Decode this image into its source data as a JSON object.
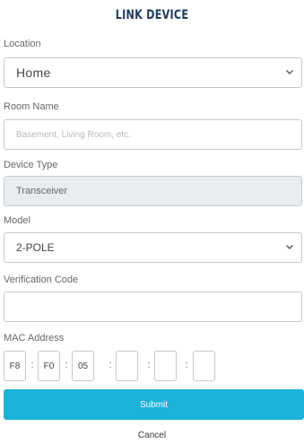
{
  "page": {
    "title": "LINK DEVICE"
  },
  "form": {
    "location": {
      "label": "Location",
      "value": "Home"
    },
    "room_name": {
      "label": "Room Name",
      "placeholder": "Basement, Living Room, etc.",
      "value": ""
    },
    "device_type": {
      "label": "Device Type",
      "value": "Transceiver"
    },
    "model": {
      "label": "Model",
      "value": "2-POLE"
    },
    "verification_code": {
      "label": "Verification Code",
      "value": ""
    },
    "mac_address": {
      "label": "MAC Address",
      "octets": [
        "F8",
        "F0",
        "05",
        "",
        "",
        ""
      ],
      "separator": ":"
    },
    "submit_label": "Submit",
    "cancel_label": "Cancel"
  },
  "colors": {
    "accent": "#1bb2d8",
    "title": "#1f3a5c",
    "disabled_bg": "#e9ecee",
    "border": "#c8c8c8"
  },
  "icons": {
    "select_arrow": "chevron-down-icon"
  }
}
